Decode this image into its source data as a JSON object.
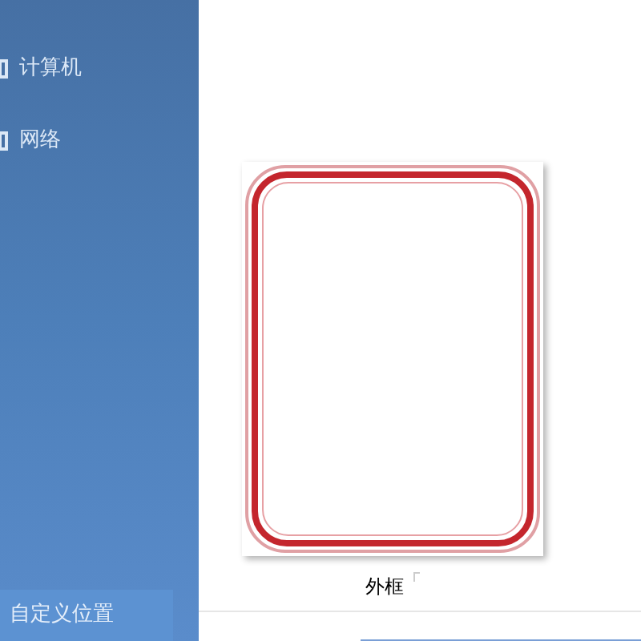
{
  "sidebar": {
    "items": [
      {
        "label": "计算机"
      },
      {
        "label": "网络"
      }
    ],
    "custom_button": "自定义位置"
  },
  "gallery": {
    "items": [
      {
        "label": "外框",
        "kind": "picture"
      }
    ]
  }
}
